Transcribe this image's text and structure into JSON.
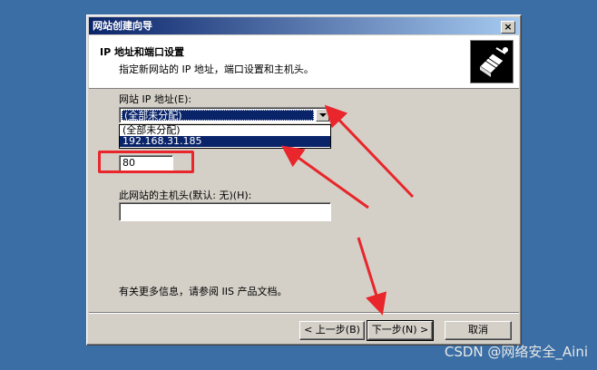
{
  "window": {
    "title": "网站创建向导",
    "close_label": "×"
  },
  "header": {
    "title": "IP 地址和端口设置",
    "subtitle": "指定新网站的 IP 地址，端口设置和主机头。",
    "icon": "wizard-book-icon"
  },
  "form": {
    "ip_label": "网站 IP 地址(E):",
    "ip_selected": "(全部未分配)",
    "ip_options": [
      "(全部未分配)",
      "192.168.31.185"
    ],
    "ip_highlighted_index": 1,
    "port_value": "80",
    "host_label": "此网站的主机头(默认: 无)(H):",
    "host_value": ""
  },
  "footer": {
    "info_text": "有关更多信息，请参阅 IIS 产品文档。",
    "back_label": "< 上一步(B)",
    "next_label": "下一步(N) >",
    "cancel_label": "取消"
  },
  "annotations": {
    "color": "#e8262b"
  },
  "watermark": "CSDN @网络安全_Aini"
}
